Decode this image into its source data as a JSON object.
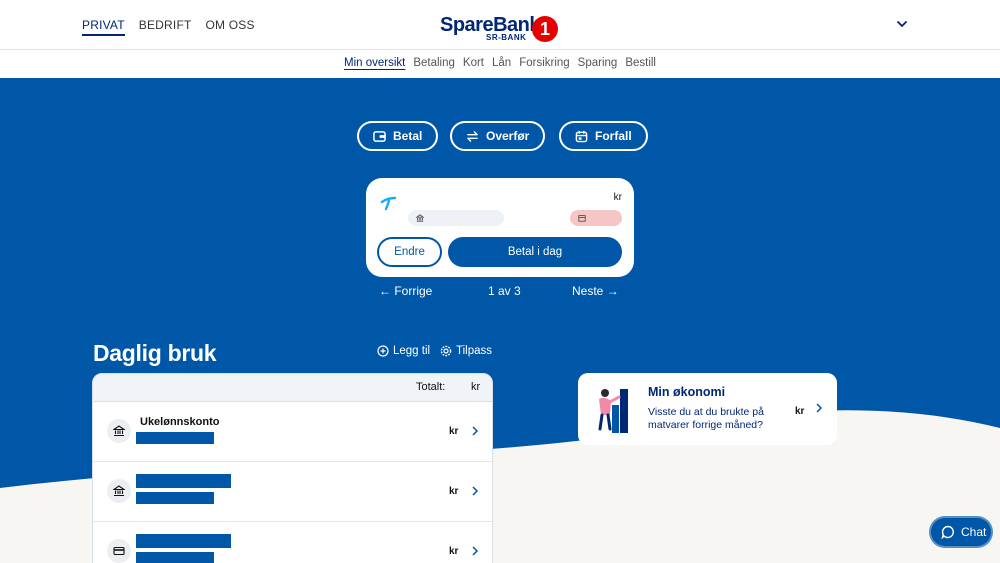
{
  "header": {
    "segments": [
      "PRIVAT",
      "BEDRIFT",
      "OM OSS"
    ],
    "active_segment": "PRIVAT",
    "logo_brand": "SpareBank",
    "logo_sub": "SR-BANK",
    "logo_number": "1"
  },
  "nav": {
    "items": [
      "Min oversikt",
      "Betaling",
      "Kort",
      "Lån",
      "Forsikring",
      "Sparing",
      "Bestill"
    ],
    "active": "Min oversikt"
  },
  "quick_actions": {
    "pay": "Betal",
    "transfer": "Overfør",
    "due": "Forfall"
  },
  "bill": {
    "currency": "kr",
    "change_label": "Endre",
    "pay_today_label": "Betal i dag"
  },
  "pager": {
    "prev": "Forrige",
    "position": "1 av 3",
    "next": "Neste"
  },
  "daily": {
    "title": "Daglig bruk",
    "add_label": "Legg til",
    "customize_label": "Tilpass",
    "total_label": "Totalt:",
    "total_currency": "kr",
    "accounts": [
      {
        "name": "Ukelønnskonto",
        "currency": "kr",
        "icon": "bank-icon"
      },
      {
        "name": "",
        "currency": "kr",
        "icon": "bank-icon"
      },
      {
        "name": "",
        "currency": "kr",
        "icon": "card-icon"
      }
    ]
  },
  "economy": {
    "title": "Min økonomi",
    "text": "Visste du at du brukte på matvarer forrige måned?",
    "currency": "kr"
  },
  "chat": {
    "label": "Chat"
  },
  "colors": {
    "brand_blue": "#0057a8",
    "dark_blue": "#002776",
    "logo_red": "#e60000"
  }
}
